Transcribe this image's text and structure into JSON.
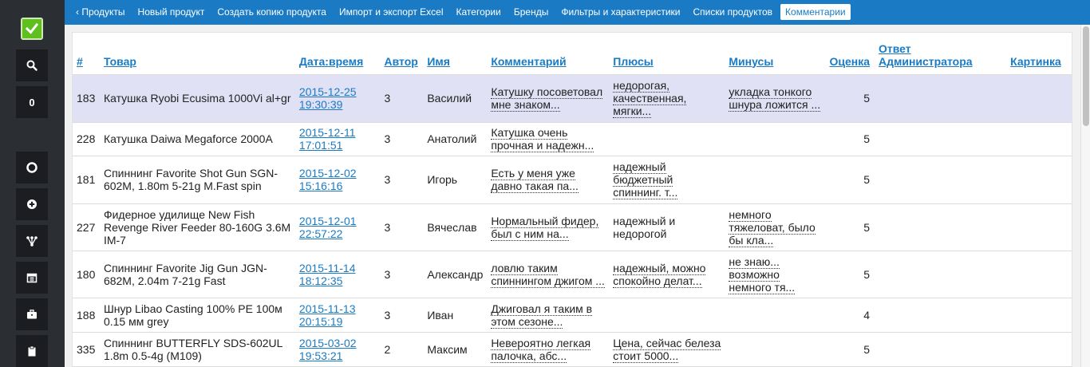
{
  "colors": {
    "accent": "#1a7bc4",
    "sidebar": "#2b2e33",
    "highlight_row": "#e1e1f6",
    "logo": "#5fbf1f"
  },
  "sidebar": {
    "logo_icon": "check-icon",
    "items": [
      {
        "icon": "search-icon"
      },
      {
        "label": "0"
      },
      {
        "icon": "lifebuoy-icon"
      },
      {
        "icon": "plus-circle-icon"
      },
      {
        "icon": "sitemap-icon"
      },
      {
        "icon": "calendar-icon"
      },
      {
        "icon": "briefcase-icon"
      },
      {
        "icon": "clipboard-icon"
      }
    ]
  },
  "nav": {
    "items": [
      {
        "label": "‹ Продукты"
      },
      {
        "label": "Новый продукт"
      },
      {
        "label": "Создать копию продукта"
      },
      {
        "label": "Импорт и экспорт Excel"
      },
      {
        "label": "Категории"
      },
      {
        "label": "Бренды"
      },
      {
        "label": "Фильтры и характеристики"
      },
      {
        "label": "Списки продуктов"
      },
      {
        "label": "Комментарии",
        "active": true
      }
    ]
  },
  "table": {
    "headers": {
      "num": "#",
      "product": "Товар",
      "datetime": "Дата:время",
      "author": "Автор",
      "name": "Имя",
      "comment": "Комментарий",
      "pros": "Плюсы",
      "cons": "Минусы",
      "rating": "Оценка",
      "admin_reply": "Ответ Администратора",
      "picture": "Картинка"
    },
    "rows": [
      {
        "id": "183",
        "product": "Катушка Ryobi Ecusima 1000Vi al+gr",
        "date": "2015-12-25",
        "time": "19:30:39",
        "author": "3",
        "name": "Василий",
        "comment": "Катушку посоветовал мне знаком...",
        "pros": "недорогая, качественная, мягки...",
        "cons": "укладка тонкого шнура ложится ...",
        "rating": "5",
        "highlight": true
      },
      {
        "id": "228",
        "product": "Катушка Daiwa Megaforce 2000A",
        "date": "2015-12-11",
        "time": "17:01:51",
        "author": "3",
        "name": "Анатолий",
        "comment": "Катушка очень прочная и надежн...",
        "pros": "",
        "cons": "",
        "rating": "5"
      },
      {
        "id": "181",
        "product": "Спиннинг Favorite Shot Gun SGN-602M, 1.80m 5-21g M.Fast spin",
        "date": "2015-12-02",
        "time": "15:16:16",
        "author": "3",
        "name": "Игорь",
        "comment": "Есть у меня уже давно такая па...",
        "pros": "надежный бюджетный спиннинг. т...",
        "cons": "",
        "rating": "5"
      },
      {
        "id": "227",
        "product": "Фидерное удилище New Fish Revenge River Feeder 80-160G 3.6M IM-7",
        "date": "2015-12-01",
        "time": "22:57:22",
        "author": "3",
        "name": "Вячеслав",
        "comment": "Нормальный фидер, был с ним на...",
        "pros": "надежный и недорогой",
        "cons": "немного тяжеловат, было бы кла...",
        "rating": "5"
      },
      {
        "id": "180",
        "product": "Спиннинг Favorite Jig Gun JGN-682M, 2.04m 7-21g Fast",
        "date": "2015-11-14",
        "time": "18:12:35",
        "author": "3",
        "name": "Александр",
        "comment": "ловлю таким спиннингом джигом ...",
        "pros": "надежный, можно спокойно делат...",
        "cons": "не знаю... возможно немного тя...",
        "rating": "5"
      },
      {
        "id": "188",
        "product": "Шнур Libao Casting 100% PE 100м 0.15 мм grey",
        "date": "2015-11-13",
        "time": "20:15:19",
        "author": "3",
        "name": "Иван",
        "comment": "Джиговал я таким в этом сезоне...",
        "pros": "",
        "cons": "",
        "rating": "4"
      },
      {
        "id": "335",
        "product": "Спиннинг BUTTERFLY SDS-602UL 1.8m 0.5-4g (M109)",
        "date": "2015-03-02",
        "time": "19:53:21",
        "author": "2",
        "name": "Максим",
        "comment": "Невероятно легкая палочка, абс...",
        "pros": "Цена, сейчас белеза стоит 5000...",
        "cons": "",
        "rating": "5"
      }
    ]
  }
}
